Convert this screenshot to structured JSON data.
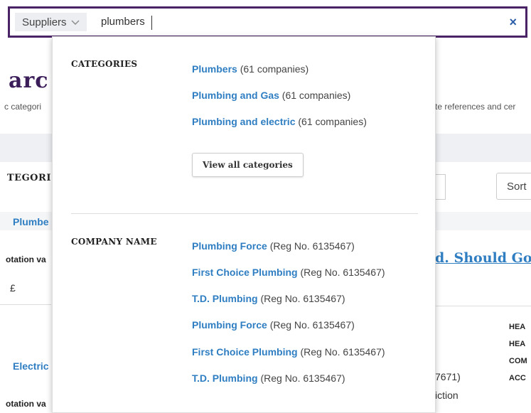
{
  "background": {
    "heading": "arc",
    "subtitle_left": "c categori",
    "subtitle_right": "te references and cer",
    "categories_label": "TEGORI",
    "sort_label": "Sort",
    "row_link_1": "Plumbe",
    "quotation_label_1": "otation va",
    "currency": "£",
    "company_link": "d. Should Go",
    "side_labels": [
      "HEA",
      "HEA",
      "COM",
      "ACC"
    ],
    "row_link_2": "Electric",
    "reg_tail": "7671)",
    "action_tail": "iction",
    "quotation_label_2": "otation va"
  },
  "search": {
    "scope_label": "Suppliers",
    "query": "plumbers",
    "clear_label": "×"
  },
  "dropdown": {
    "categories_heading": "CATEGORIES",
    "categories": [
      {
        "name": "Plumbers",
        "count": "(61 companies)"
      },
      {
        "name": "Plumbing and Gas",
        "count": "(61 companies)"
      },
      {
        "name": "Plumbing and electric",
        "count": "(61 companies)"
      }
    ],
    "view_all_label": "View all categories",
    "company_heading": "COMPANY NAME",
    "companies": [
      {
        "name": "Plumbing Force",
        "reg": "(Reg No. 6135467)"
      },
      {
        "name": "First Choice Plumbing",
        "reg": "(Reg No. 6135467)"
      },
      {
        "name": "T.D. Plumbing",
        "reg": "(Reg No. 6135467)"
      },
      {
        "name": "Plumbing Force",
        "reg": "(Reg No. 6135467)"
      },
      {
        "name": "First Choice Plumbing",
        "reg": "(Reg No. 6135467)"
      },
      {
        "name": "T.D. Plumbing",
        "reg": "(Reg No. 6135467)"
      }
    ]
  },
  "colors": {
    "brand_purple": "#4a2366",
    "link_blue": "#2f7ec2",
    "clear_blue": "#2b5ea8"
  }
}
